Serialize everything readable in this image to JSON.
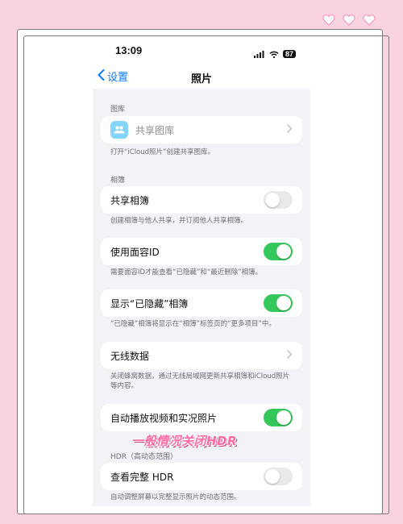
{
  "status_bar": {
    "time": "13:09",
    "battery": "87"
  },
  "nav": {
    "back_label": "设置",
    "title": "照片"
  },
  "library": {
    "section_label": "图库",
    "shared_library_label": "共享图库",
    "footnote": "打开“iCloud照片”创建共享图库。"
  },
  "albums": {
    "section_label": "相簿",
    "shared_albums_label": "共享相簿",
    "shared_albums_on": false,
    "shared_albums_footnote": "创建相簿与他人共享，并订阅他人共享相簿。"
  },
  "face_id": {
    "label": "使用面容ID",
    "on": true,
    "footnote": "需要面容ID才能查看“已隐藏”和“最近删除”相簿。"
  },
  "hidden_album": {
    "label": "显示“已隐藏”相簿",
    "on": true,
    "footnote": "“已隐藏”相簿将显示在“相簿”标签页的“更多项目”中。"
  },
  "wireless_data": {
    "label": "无线数据",
    "footnote": "关闭蜂窝数据，通过无线局域网更新共享相簿和iCloud照片等内容。"
  },
  "autoplay": {
    "label": "自动播放视频和实况照片",
    "on": true
  },
  "hdr": {
    "section_label": "HDR（高动态范围）",
    "label": "查看完整 HDR",
    "on": false,
    "footnote": "自动调整屏幕以完整显示照片的动态范围。"
  },
  "overlay_caption": "一般情况关闭HDR",
  "colors": {
    "background_pink": "#f9d3e0",
    "ios_blue": "#0a7aff",
    "toggle_green": "#34c759",
    "caption_pink": "#ff6aa6"
  },
  "icons": {
    "decoration": "heart-icon",
    "back": "chevron-left-icon",
    "shared_library": "people-icon",
    "row_disclosure": "chevron-right-icon"
  }
}
